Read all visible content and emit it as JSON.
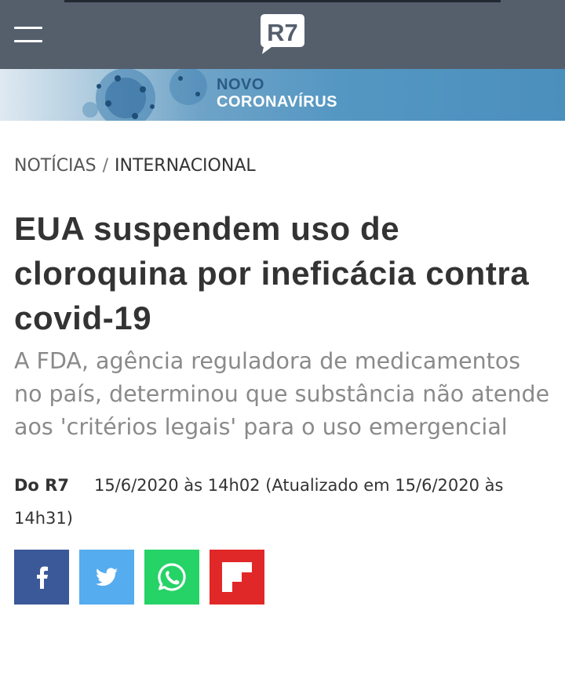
{
  "header": {
    "logo_text": "R7",
    "menu_icon": "hamburger-menu-icon"
  },
  "banner": {
    "line1": "NOVO",
    "line2": "CORONAVÍRUS"
  },
  "breadcrumb": {
    "section": "NOTÍCIAS",
    "separator": "/",
    "subsection": "INTERNACIONAL"
  },
  "article": {
    "headline": "EUA suspendem uso de cloroquina por ineficácia contra covid-19",
    "subtitle": "A FDA, agência reguladora de medicamentos no país, determinou que substância não atende aos 'critérios legais' para o uso emergencial",
    "author": "Do R7",
    "published": "15/6/2020 às 14h02 (Atualizado em 15/6/2020 às 14h31)"
  },
  "share": [
    {
      "name": "facebook",
      "icon": "facebook-icon",
      "color": "#3b5998"
    },
    {
      "name": "twitter",
      "icon": "twitter-icon",
      "color": "#55acee"
    },
    {
      "name": "whatsapp",
      "icon": "whatsapp-icon",
      "color": "#25d366"
    },
    {
      "name": "flipboard",
      "icon": "flipboard-icon",
      "color": "#e12828"
    }
  ],
  "colors": {
    "header_bg": "#555f6c",
    "headline": "#333333",
    "subtitle": "#8a8a8a"
  }
}
